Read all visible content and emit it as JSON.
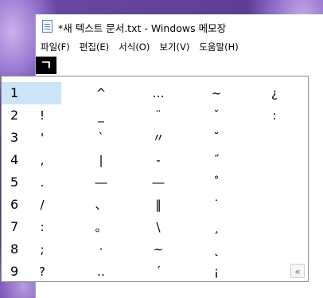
{
  "window": {
    "title": "*새 텍스트 문서.txt - Windows 메모장",
    "icon": "notepad-icon"
  },
  "menu": [
    {
      "label": "파일(F)"
    },
    {
      "label": "편집(E)"
    },
    {
      "label": "서식(O)"
    },
    {
      "label": "보기(V)"
    },
    {
      "label": "도움말(H)"
    }
  ],
  "ime": {
    "composition": "ㄱ"
  },
  "candidates": {
    "rows": [
      {
        "num": "1",
        "cells": [
          "",
          "^",
          "…",
          "~",
          "¿"
        ]
      },
      {
        "num": "2",
        "cells": [
          "!",
          "_",
          "¨",
          "ˇ",
          ":"
        ]
      },
      {
        "num": "3",
        "cells": [
          "'",
          "`",
          "〃",
          "˘",
          ""
        ]
      },
      {
        "num": "4",
        "cells": [
          ",",
          "|",
          "-",
          "˝",
          ""
        ]
      },
      {
        "num": "5",
        "cells": [
          ".",
          "―",
          "―",
          "˚",
          ""
        ]
      },
      {
        "num": "6",
        "cells": [
          "/",
          "、",
          "‖",
          "˙",
          ""
        ]
      },
      {
        "num": "7",
        "cells": [
          ":",
          "。",
          "\\",
          "¸",
          ""
        ]
      },
      {
        "num": "8",
        "cells": [
          ";",
          "·",
          "∼",
          "˛",
          ""
        ]
      },
      {
        "num": "9",
        "cells": [
          "?",
          "‥",
          "´",
          "¡",
          ""
        ]
      }
    ],
    "selected_index": 0,
    "expand_icon": "«"
  }
}
